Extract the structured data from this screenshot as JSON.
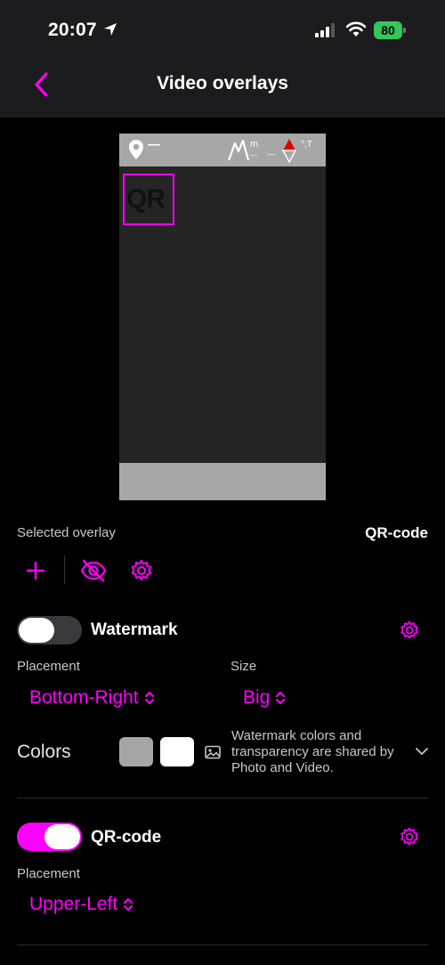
{
  "status_bar": {
    "time": "20:07",
    "battery": "80"
  },
  "nav": {
    "title": "Video overlays"
  },
  "preview": {
    "m_label": "m",
    "m_value": "---",
    "m_dash": "__",
    "temp_label": "°,T",
    "qr_text": "QR"
  },
  "selected_overlay": {
    "label": "Selected overlay",
    "value": "QR-code"
  },
  "watermark": {
    "title": "Watermark",
    "enabled": false,
    "placement_label": "Placement",
    "placement_value": "Bottom-Right",
    "size_label": "Size",
    "size_value": "Big",
    "colors_label": "Colors",
    "swatch_1": "#a6a6a6",
    "swatch_2": "#ffffff",
    "note": "Watermark colors and transparency are shared by Photo and Video."
  },
  "qr_code": {
    "title": "QR-code",
    "enabled": true,
    "placement_label": "Placement",
    "placement_value": "Upper-Left"
  },
  "colors": {
    "accent": "#ff00ff",
    "toggle_off": "#3a3a3c",
    "battery": "#34c759"
  },
  "icons": [
    "location-arrow-icon",
    "signal-icon",
    "wifi-icon",
    "battery-icon",
    "back-chevron-icon",
    "map-pin-icon",
    "mountain-icon",
    "compass-icon",
    "plus-icon",
    "eye-slash-icon",
    "gear-icon",
    "chevron-updown-icon",
    "image-icon",
    "chevron-down-icon"
  ]
}
